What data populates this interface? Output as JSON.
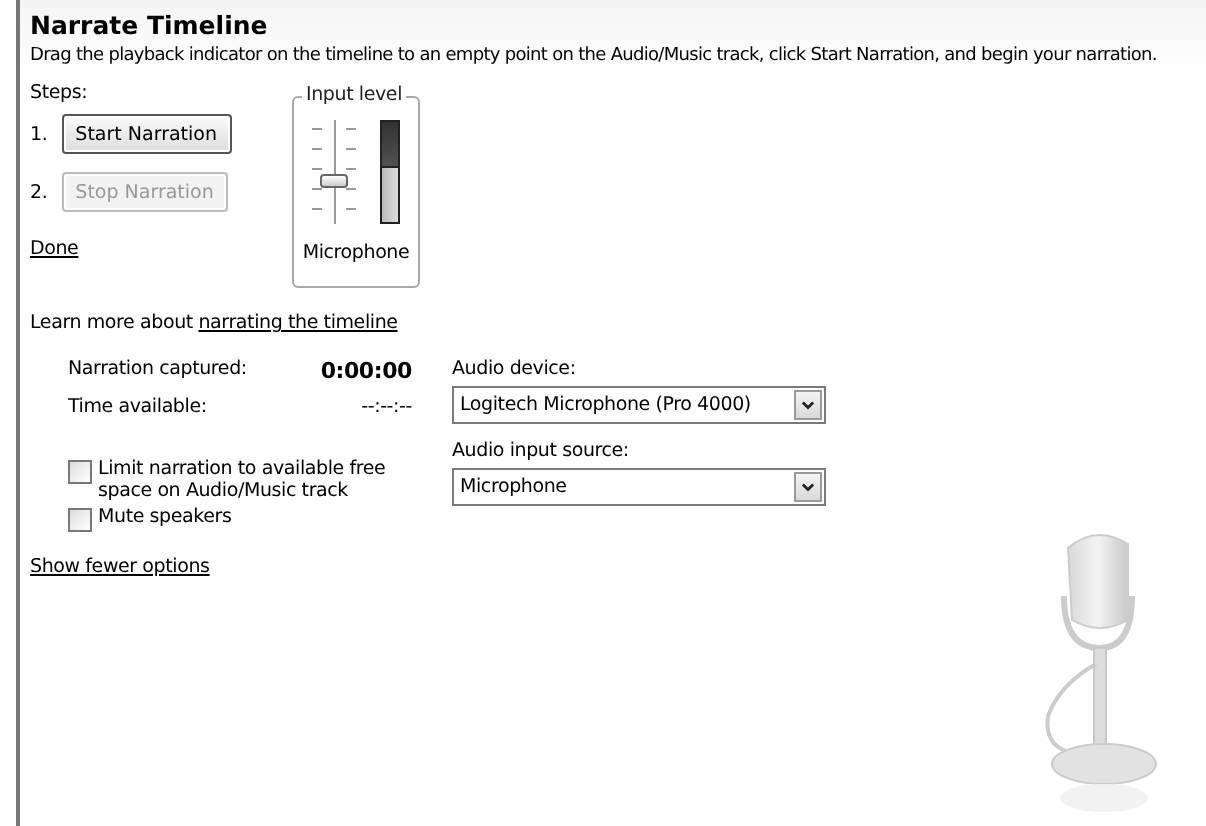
{
  "panel": {
    "title": "Narrate Timeline",
    "description": "Drag the playback indicator on the timeline to an empty point on the Audio/Music track, click Start Narration, and begin your narration."
  },
  "steps": {
    "label": "Steps:",
    "items": [
      {
        "number": "1.",
        "button": "Start Narration",
        "disabled": false
      },
      {
        "number": "2.",
        "button": "Stop Narration",
        "disabled": true
      }
    ],
    "done_link": "Done"
  },
  "input_level": {
    "title": "Input level",
    "slider": {
      "level": 0.4
    },
    "meter": {
      "level": 0.55
    },
    "source": "Microphone"
  },
  "learn_more": {
    "text": "Learn more about ",
    "link": "narrating the timeline"
  },
  "stats": [
    {
      "label": "Narration captured:",
      "value": "0:00:00",
      "bold": true
    },
    {
      "label": "Time available:",
      "value": "--:--:--",
      "bold": false
    }
  ],
  "options": [
    {
      "label": "Limit narration to available free space on Audio/Music track",
      "checked": false
    },
    {
      "label": "Mute speakers",
      "checked": false
    }
  ],
  "dropdowns": [
    {
      "label": "Audio device:",
      "value": "Logitech Microphone (Pro 4000)"
    },
    {
      "label": "Audio input source:",
      "value": "Microphone"
    }
  ],
  "toggle_link": "Show fewer options"
}
